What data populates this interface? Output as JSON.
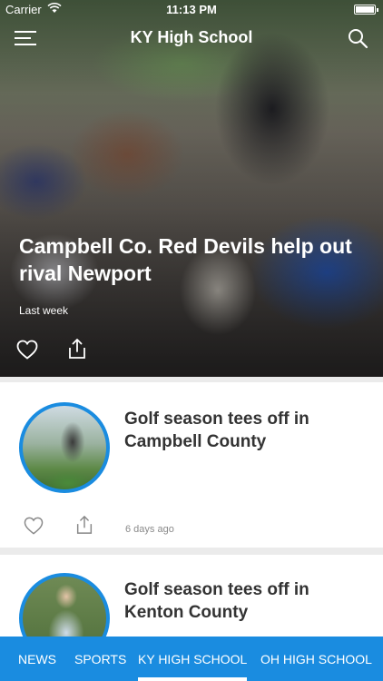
{
  "status_bar": {
    "carrier": "Carrier",
    "time": "11:13 PM",
    "wifi_icon": "wifi-icon",
    "battery_icon": "battery-icon"
  },
  "header": {
    "title": "KY High School",
    "menu_icon": "hamburger-menu-icon",
    "search_icon": "search-icon"
  },
  "hero": {
    "title": "Campbell Co. Red Devils help out rival Newport",
    "time": "Last week",
    "like_icon": "heart-icon",
    "share_icon": "share-icon"
  },
  "articles": [
    {
      "title": "Golf season tees off in Campbell County",
      "time": "6 days ago",
      "like_icon": "heart-icon",
      "share_icon": "share-icon"
    },
    {
      "title": "Golf season tees off in Kenton County"
    }
  ],
  "tabs": [
    {
      "label": "NEWS",
      "selected": false
    },
    {
      "label": "SPORTS",
      "selected": false
    },
    {
      "label": "KY HIGH SCHOOL",
      "selected": true
    },
    {
      "label": "OH HIGH SCHOOL",
      "selected": false
    }
  ],
  "colors": {
    "accent": "#1a8ce0",
    "title_text": "#333333",
    "muted_text": "#8a8a8a",
    "background": "#ebebeb"
  }
}
